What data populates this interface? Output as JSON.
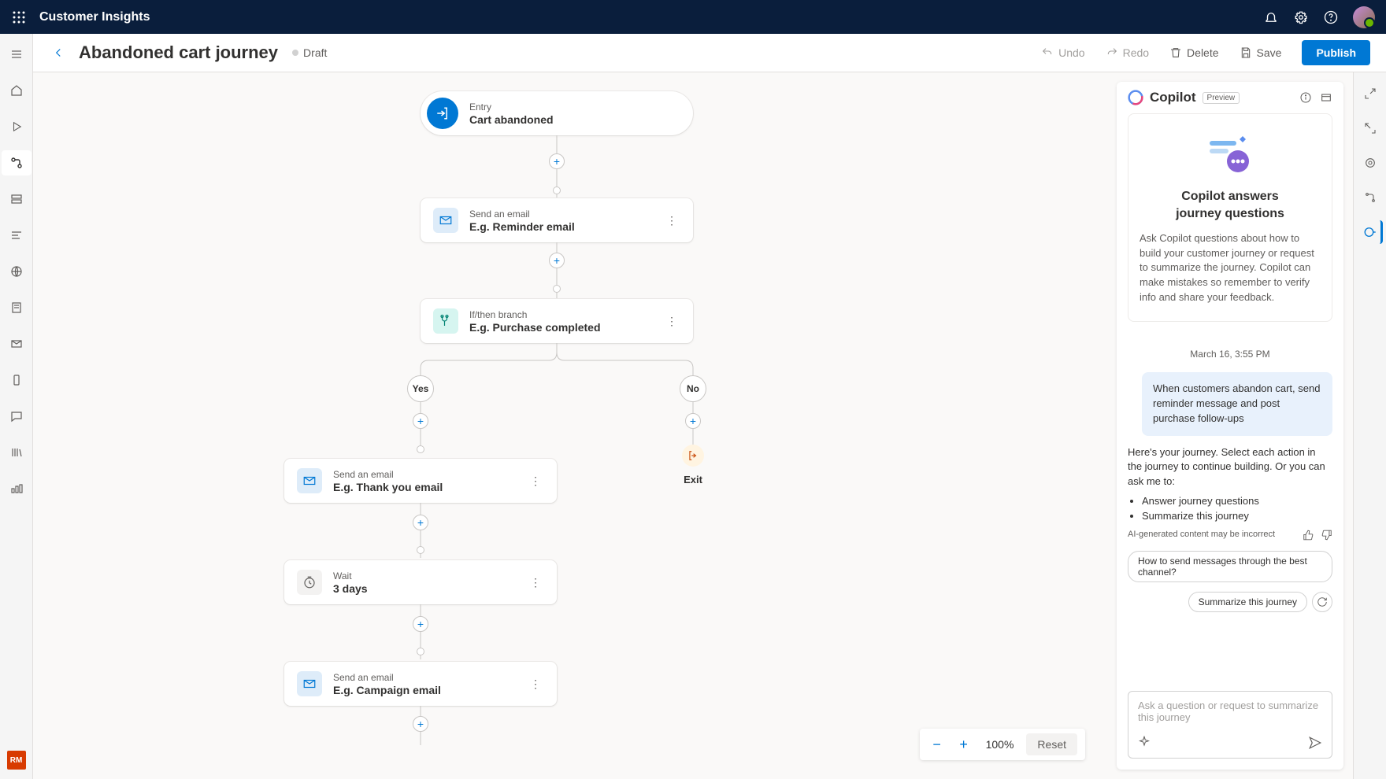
{
  "app": {
    "name": "Customer Insights"
  },
  "header": {
    "title": "Abandoned cart journey",
    "status": "Draft",
    "undo": "Undo",
    "redo": "Redo",
    "delete": "Delete",
    "save": "Save",
    "publish": "Publish"
  },
  "leftbar": {
    "rm": "RM"
  },
  "flow": {
    "entry": {
      "label": "Entry",
      "title": "Cart abandoned"
    },
    "email1": {
      "label": "Send an email",
      "title": "E.g. Reminder email"
    },
    "branch": {
      "label": "If/then branch",
      "title": "E.g. Purchase completed",
      "yes": "Yes",
      "no": "No"
    },
    "email2": {
      "label": "Send an email",
      "title": "E.g. Thank you email"
    },
    "wait": {
      "label": "Wait",
      "title": "3 days"
    },
    "email3": {
      "label": "Send an email",
      "title": "E.g. Campaign email"
    },
    "exit": "Exit"
  },
  "zoom": {
    "value": "100%",
    "reset": "Reset"
  },
  "copilot": {
    "title": "Copilot",
    "preview": "Preview",
    "card_title1": "Copilot answers",
    "card_title2": "journey questions",
    "card_body": "Ask Copilot questions about how to build your customer journey or request to summarize the journey. Copilot can make mistakes so remember to verify info and share your feedback.",
    "timestamp": "March 16, 3:55 PM",
    "user_msg": "When customers abandon cart, send reminder message and post purchase follow-ups",
    "ai_msg_intro": "Here's your journey. Select each action in the journey to continue building. Or you can ask me to:",
    "ai_bullet1": "Answer journey questions",
    "ai_bullet2": "Summarize this journey",
    "disclaimer": "AI-generated content may be incorrect",
    "chip1": "How to send messages through the best channel?",
    "chip2": "Summarize this journey",
    "placeholder": "Ask a question or request to summarize this journey"
  }
}
